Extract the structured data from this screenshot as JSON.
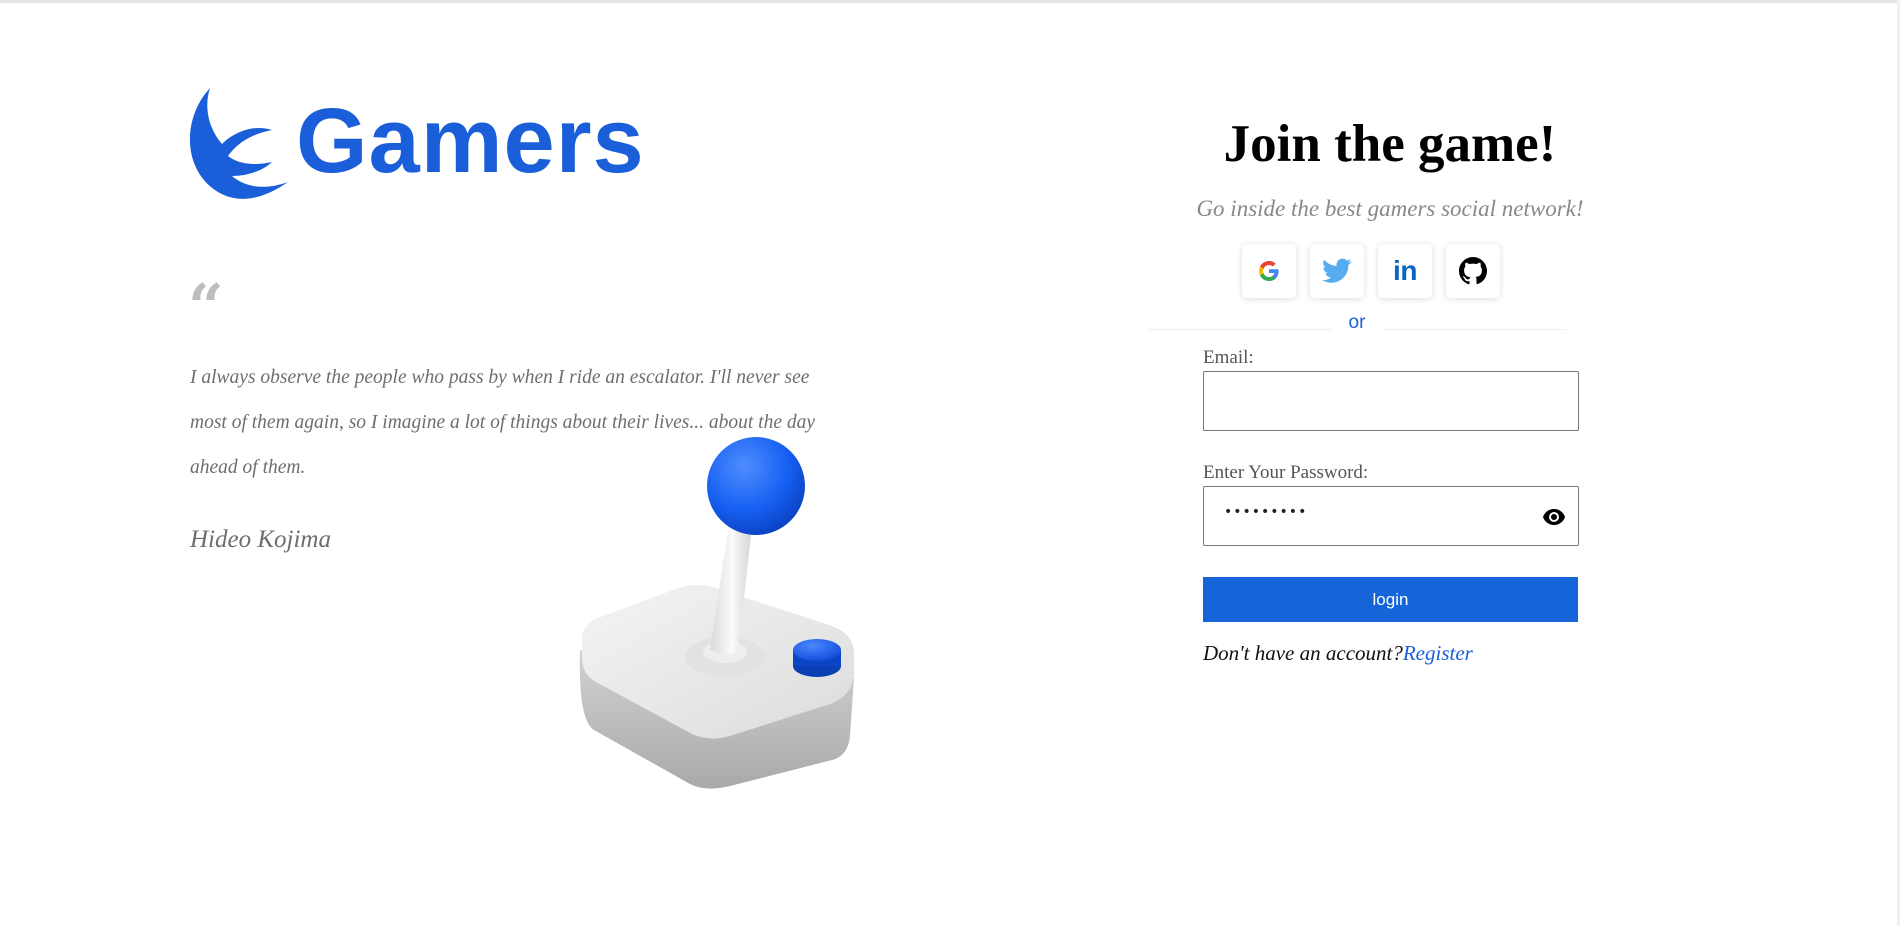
{
  "brand": {
    "name": "Gamers",
    "color": "#1a5fd9",
    "logo_icon": "swirl-logo-icon"
  },
  "quote": {
    "mark": "“",
    "text": "I always observe the people who pass by when I ride an escalator. I'll never see most of them again, so I imagine a lot of things about their lives... about the day ahead of them.",
    "author": "Hideo Kojima"
  },
  "illustration": {
    "icon": "joystick-illustration"
  },
  "signup": {
    "title": "Join the game!",
    "subtitle": "Go inside the best gamers social network!",
    "socials": [
      {
        "name": "google",
        "icon": "google-icon"
      },
      {
        "name": "twitter",
        "icon": "twitter-icon",
        "color": "#55acee"
      },
      {
        "name": "linkedin",
        "icon": "linkedin-icon",
        "label": "in",
        "color": "#0a66c2"
      },
      {
        "name": "github",
        "icon": "github-icon",
        "color": "#000000"
      }
    ],
    "divider_text": "or",
    "email": {
      "label": "Email:",
      "value": ""
    },
    "password": {
      "label": "Enter Your Password:",
      "value": "•••••••••",
      "toggle_icon": "eye-icon"
    },
    "login_label": "login",
    "login_color": "#1565d8",
    "no_account_text": "Don't have an account?",
    "register_label": "Register"
  }
}
